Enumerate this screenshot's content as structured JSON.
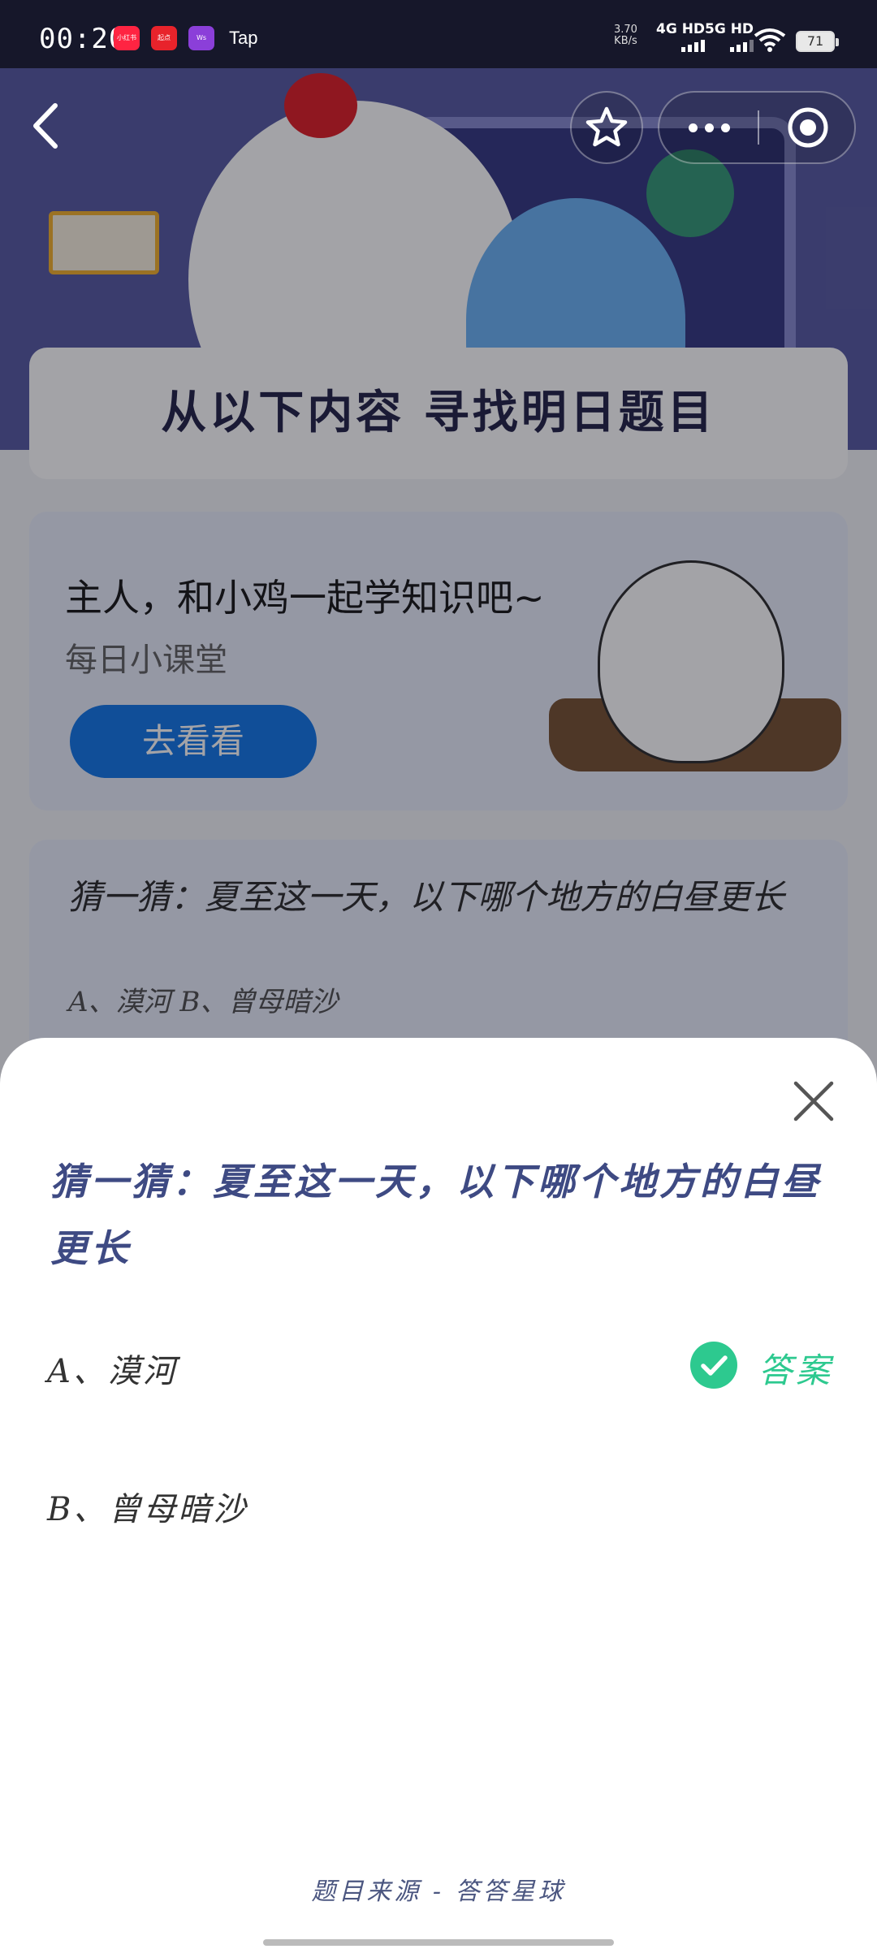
{
  "status_bar": {
    "time": "00:20",
    "apps": [
      {
        "label": "小红书",
        "color": "#ff2442"
      },
      {
        "label": "起点",
        "color": "#e8232b"
      },
      {
        "label": "Ws",
        "color": "#8b3fd9"
      }
    ],
    "tap_label": "Tap",
    "net_speed_value": "3.70",
    "net_speed_unit": "KB/s",
    "signal_1": "4G HD",
    "signal_2": "5G HD",
    "battery": "71"
  },
  "nav": {
    "back_icon": "chevron-left-icon",
    "star_icon": "star-outline-icon",
    "more_icon": "more-dots-icon",
    "close_icon": "target-close-icon"
  },
  "background_page": {
    "title": "从以下内容  寻找明日题目",
    "study_card": {
      "title": "主人，和小鸡一起学知识吧~",
      "subtitle": "每日小课堂",
      "button": "去看看"
    },
    "question_card": {
      "question": "猜一猜：夏至这一天，以下哪个地方的白昼更长",
      "options": "A、漠河    B、曾母暗沙"
    }
  },
  "sheet": {
    "question": "猜一猜：夏至这一天，以下哪个地方的白昼更长",
    "options": [
      {
        "label": "A、漠河",
        "is_answer": true
      },
      {
        "label": "B、曾母暗沙",
        "is_answer": false
      }
    ],
    "answer_label": "答案",
    "source": "题目来源 - 答答星球",
    "accent_color": "#2dc98f",
    "question_color": "#3e4a83"
  }
}
